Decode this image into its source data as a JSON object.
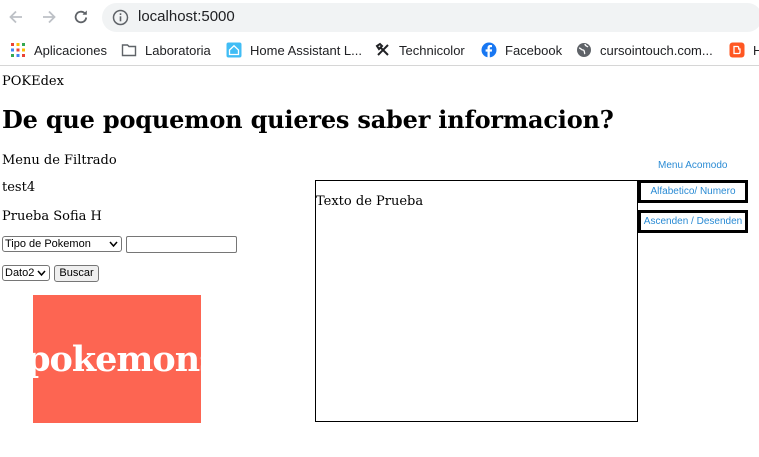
{
  "browser": {
    "url": "localhost:5000",
    "bookmarks": [
      {
        "label": "Aplicaciones",
        "icon": "apps-grid-icon"
      },
      {
        "label": "Laboratoria",
        "icon": "folder-icon"
      },
      {
        "label": "Home Assistant L...",
        "icon": "home-assistant-icon"
      },
      {
        "label": "Technicolor",
        "icon": "tools-icon"
      },
      {
        "label": "Facebook",
        "icon": "facebook-icon"
      },
      {
        "label": "cursointouch.com...",
        "icon": "globe-icon"
      },
      {
        "label": "H",
        "icon": "blogger-icon"
      }
    ]
  },
  "page": {
    "brand": "POKEdex",
    "heading": "De que poquemon quieres saber informacion?",
    "filter_menu_label": "Menu de Filtrado",
    "test_text": "test4",
    "author_text": "Prueba Sofia H",
    "type_select": "Tipo de Pokemon",
    "search_value": "",
    "data_select": "Dato2",
    "search_button": "Buscar",
    "image_text": "pokemons",
    "result_text": "Texto de Prueba",
    "sort_menu_label": "Menu Acomodo",
    "sort_alpha_button": "Alfabetico/ Numero",
    "sort_order_button": "Ascenden / Desenden"
  },
  "colors": {
    "image_bg": "#fd6552",
    "link": "#2a8bd4"
  }
}
